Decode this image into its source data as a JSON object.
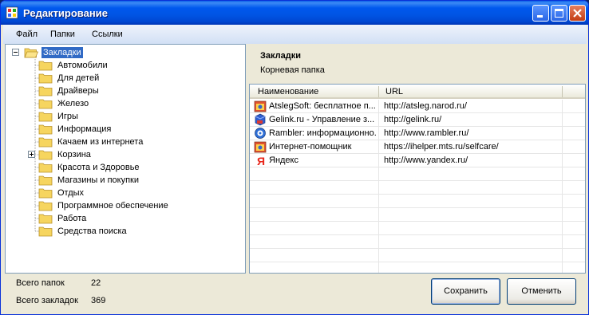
{
  "window": {
    "title": "Редактирование"
  },
  "menu": {
    "items": [
      "Файл",
      "Папки",
      "Ссылки"
    ]
  },
  "tree": {
    "root": "Закладки",
    "folders": [
      "Автомобили",
      "Для детей",
      "Драйверы",
      "Железо",
      "Игры",
      "Информация",
      "Качаем из интернета",
      "Корзина",
      "Красота и Здоровье",
      "Магазины и покупки",
      "Отдых",
      "Программное обеспечение",
      "Работа",
      "Средства поиска"
    ],
    "expandable_folder": "Корзина"
  },
  "folder_info": {
    "title": "Закладки",
    "description": "Корневая папка"
  },
  "grid": {
    "columns": [
      "Наименование",
      "URL"
    ],
    "rows": [
      {
        "name": "AtslegSoft: бесплатное п...",
        "url": "http://atsleg.narod.ru/",
        "icon": "atslegsoft-favicon"
      },
      {
        "name": "Gelink.ru - Управление з...",
        "url": "http://gelink.ru/",
        "icon": "gelink-favicon"
      },
      {
        "name": "Rambler: информационно...",
        "url": "http://www.rambler.ru/",
        "icon": "rambler-favicon"
      },
      {
        "name": "Интернет-помощник",
        "url": "https://ihelper.mts.ru/selfcare/",
        "icon": "mts-favicon"
      },
      {
        "name": "Яндекс",
        "url": "http://www.yandex.ru/",
        "icon": "yandex-favicon"
      }
    ]
  },
  "stats": {
    "folders_label": "Всего папок",
    "folders_value": "22",
    "bookmarks_label": "Всего закладок",
    "bookmarks_value": "369"
  },
  "buttons": {
    "save": "Сохранить",
    "cancel": "Отменить"
  }
}
